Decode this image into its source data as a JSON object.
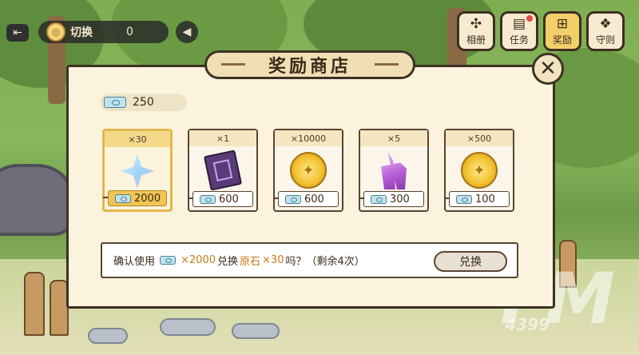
{
  "hud": {
    "back_icon": "back-arrow-icon",
    "switch_label": "切换",
    "switch_count": "0",
    "sound_icon": "speaker-icon"
  },
  "right_tabs": [
    {
      "label": "相册",
      "icon": "puzzle-icon"
    },
    {
      "label": "任务",
      "icon": "book-icon"
    },
    {
      "label": "奖励",
      "icon": "gift-icon"
    },
    {
      "label": "守则",
      "icon": "rules-icon"
    }
  ],
  "dialog": {
    "title": "奖励商店",
    "close_icon": "close-icon"
  },
  "balance": {
    "value": "250"
  },
  "items": [
    {
      "qty": "×30",
      "price": "2000",
      "art": "star-gem",
      "selected": true
    },
    {
      "qty": "×1",
      "price": "600",
      "art": "book",
      "selected": false
    },
    {
      "qty": "×10000",
      "price": "600",
      "art": "coin",
      "selected": false
    },
    {
      "qty": "×5",
      "price": "300",
      "art": "crystal",
      "selected": false
    },
    {
      "qty": "×500",
      "price": "100",
      "art": "coin",
      "selected": false
    }
  ],
  "confirm": {
    "prefix": "确认使用",
    "amount": "×2000",
    "mid": "兑换",
    "item_name": "原石",
    "item_qty": " ×30",
    "suffix": "吗？（剩余4次）",
    "button_label": "兑换"
  },
  "watermark": {
    "logo_text": "FM",
    "sub_text": "4399"
  },
  "colors": {
    "dialog_bg": "#fbf3de",
    "accent_gold": "#f2c456",
    "highlight_text": "#c57a17"
  }
}
